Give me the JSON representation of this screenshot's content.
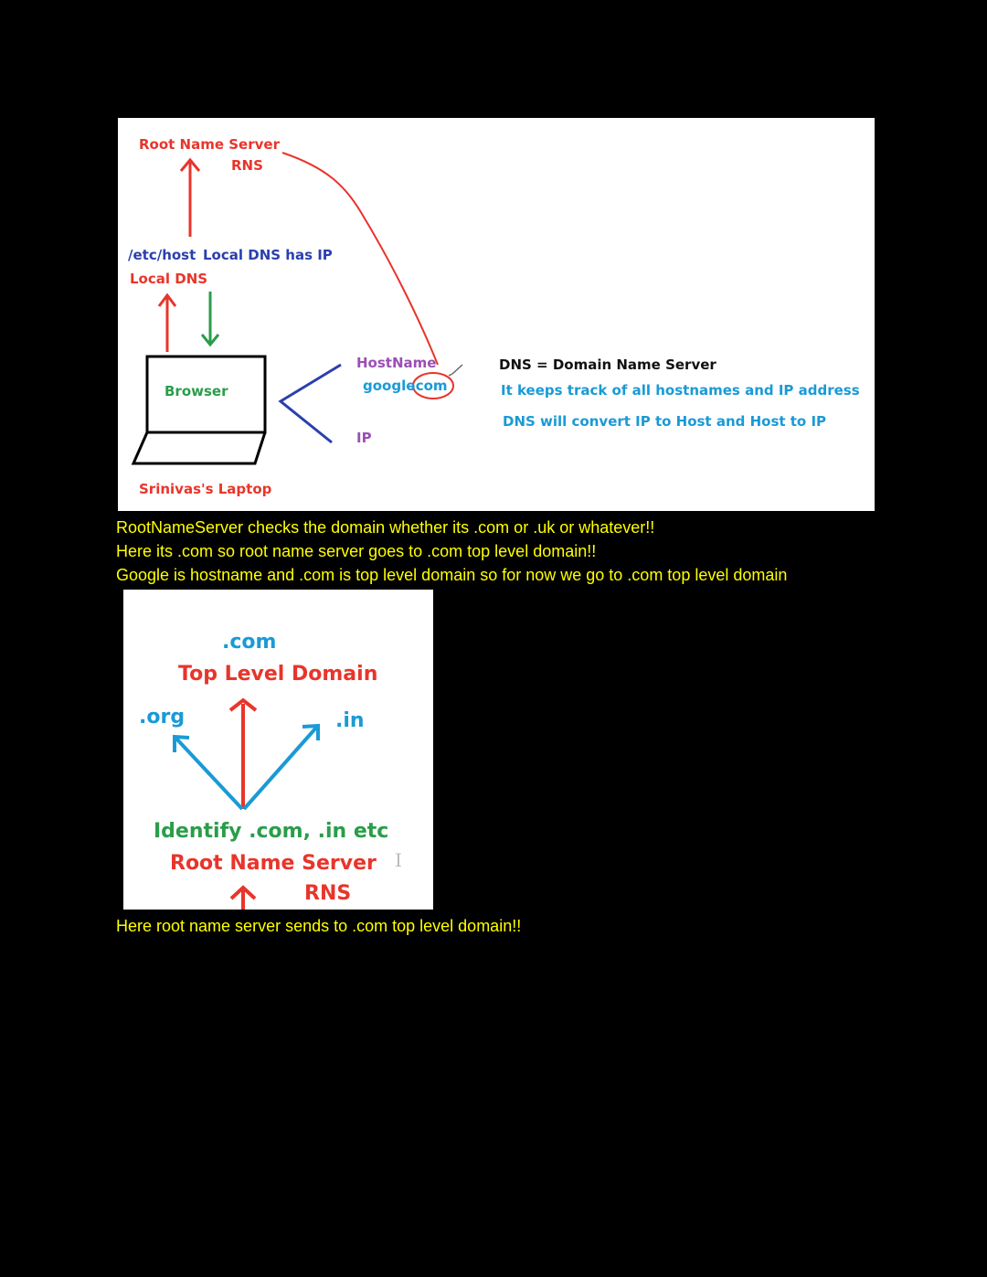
{
  "diagram1": {
    "root_name_server": "Root Name Server",
    "rns": "RNS",
    "etc_host": "/etc/host",
    "local_dns_has_ip": "Local DNS has IP",
    "local_dns": "Local DNS",
    "browser": "Browser",
    "laptop": "Srinivas's Laptop",
    "hostname": "HostName",
    "google": "google",
    "dot_com": ".com",
    "ip": "IP",
    "dns_definition": "DNS = Domain Name Server",
    "keeps_track": "It keeps track of all hostnames and IP address",
    "converts": "DNS will convert IP to Host and Host to IP"
  },
  "notes": {
    "line1": "RootNameServer checks the domain whether its .com or .uk or whatever!!",
    "line2": "Here its .com so root name server goes to .com top level domain!!",
    "line3": "Google is hostname and .com is top level domain so for now we go to .com top level domain",
    "line4": "Here root name server sends to .com top level domain!!"
  },
  "diagram2": {
    "com": ".com",
    "top_level_domain": "Top Level Domain",
    "org": ".org",
    "in": ".in",
    "identify": "Identify .com, .in  etc",
    "root_name_server": "Root Name Server",
    "rns": "RNS"
  },
  "colors": {
    "red": "#e8352b",
    "green": "#2a9d4a",
    "blue": "#2b3fae",
    "purple": "#9b4fb5",
    "cyan": "#1a9ad6",
    "note_yellow": "#ffff00",
    "background": "#000000"
  }
}
